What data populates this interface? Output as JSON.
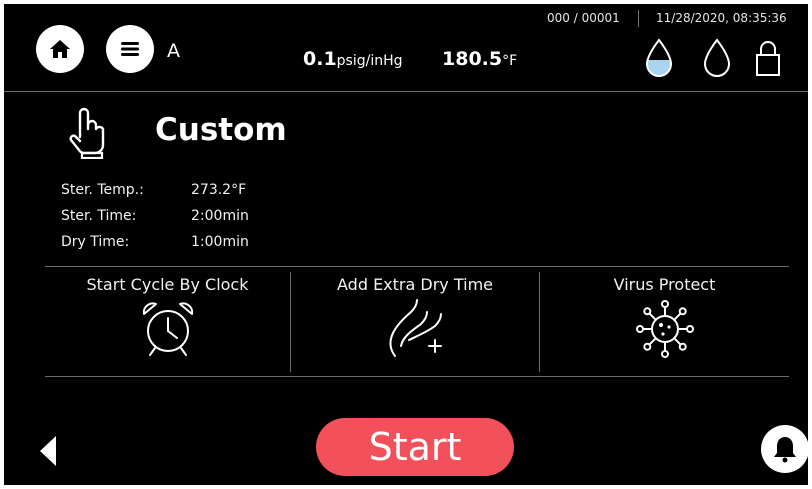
{
  "header": {
    "profile_letter": "A",
    "counter": "000 / 00001",
    "datetime": "11/28/2020, 08:35:36",
    "pressure_value": "0.1",
    "pressure_unit": "psig/inHg",
    "temperature_value": "180.5",
    "temperature_unit": "°F"
  },
  "icons": {
    "home": "home-icon",
    "menu": "menu-icon",
    "water_level": "water-drop-filled-icon",
    "water": "water-drop-icon",
    "lock": "lock-icon",
    "cycle": "hand-pointer-icon",
    "clock": "alarm-clock-icon",
    "dry": "add-dry-time-icon",
    "virus": "virus-icon",
    "back": "back-arrow-icon",
    "bell": "bell-icon"
  },
  "cycle": {
    "title": "Custom",
    "params": [
      {
        "label": "Ster. Temp.:",
        "value": "273.2°F"
      },
      {
        "label": "Ster. Time:",
        "value": "2:00min"
      },
      {
        "label": "Dry Time:",
        "value": "1:00min"
      }
    ]
  },
  "options": [
    {
      "label": "Start Cycle By Clock"
    },
    {
      "label": "Add Extra Dry Time"
    },
    {
      "label": "Virus Protect"
    }
  ],
  "start_label": "Start",
  "colors": {
    "background": "#000000",
    "start_button": "#f2505b",
    "water_fill": "#a8d4ef",
    "divider": "#6c6c6c"
  }
}
